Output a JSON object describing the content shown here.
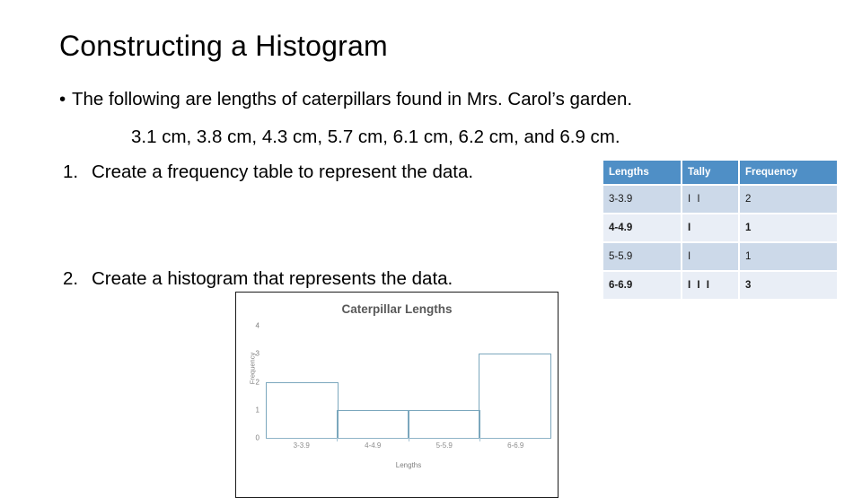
{
  "slide": {
    "title": "Constructing a Histogram"
  },
  "body": {
    "bullet_mark": "•",
    "bullet_text": "The following are lengths of caterpillars found in Mrs. Carol’s garden.",
    "data_values": "3.1 cm, 3.8 cm, 4.3 cm, 5.7 cm, 6.1 cm, 6.2 cm, and 6.9 cm.",
    "steps": [
      {
        "number": "1.",
        "text": "Create a frequency table to represent the data."
      },
      {
        "number": "2.",
        "text": "Create a histogram that represents the data."
      }
    ]
  },
  "frequency_table": {
    "headers": [
      "Lengths",
      "Tally",
      "Frequency"
    ],
    "rows": [
      {
        "lengths": "3-3.9",
        "tally": "I I",
        "frequency": "2"
      },
      {
        "lengths": "4-4.9",
        "tally": "I",
        "frequency": "1"
      },
      {
        "lengths": "5-5.9",
        "tally": "I",
        "frequency": "1"
      },
      {
        "lengths": "6-6.9",
        "tally": "I I I",
        "frequency": "3"
      }
    ],
    "header_color": "#4f8fc6",
    "row_odd_color": "#ccd9e9",
    "row_even_color": "#e9eef6"
  },
  "chart_data": {
    "type": "bar",
    "title": "Caterpillar Lengths",
    "xlabel": "Lengths",
    "ylabel": "Frequency",
    "categories": [
      "3-3.9",
      "4-4.9",
      "5-5.9",
      "6-6.9"
    ],
    "values": [
      2,
      1,
      1,
      3
    ],
    "ylim": [
      0,
      4
    ],
    "yticks": [
      "4",
      "3",
      "2",
      "1",
      "0"
    ],
    "grid": false,
    "legend": false,
    "bar_outline_color": "#7ba7bd",
    "bar_fill": "none",
    "title_color": "#595959",
    "tick_color": "#7f7f7f"
  }
}
